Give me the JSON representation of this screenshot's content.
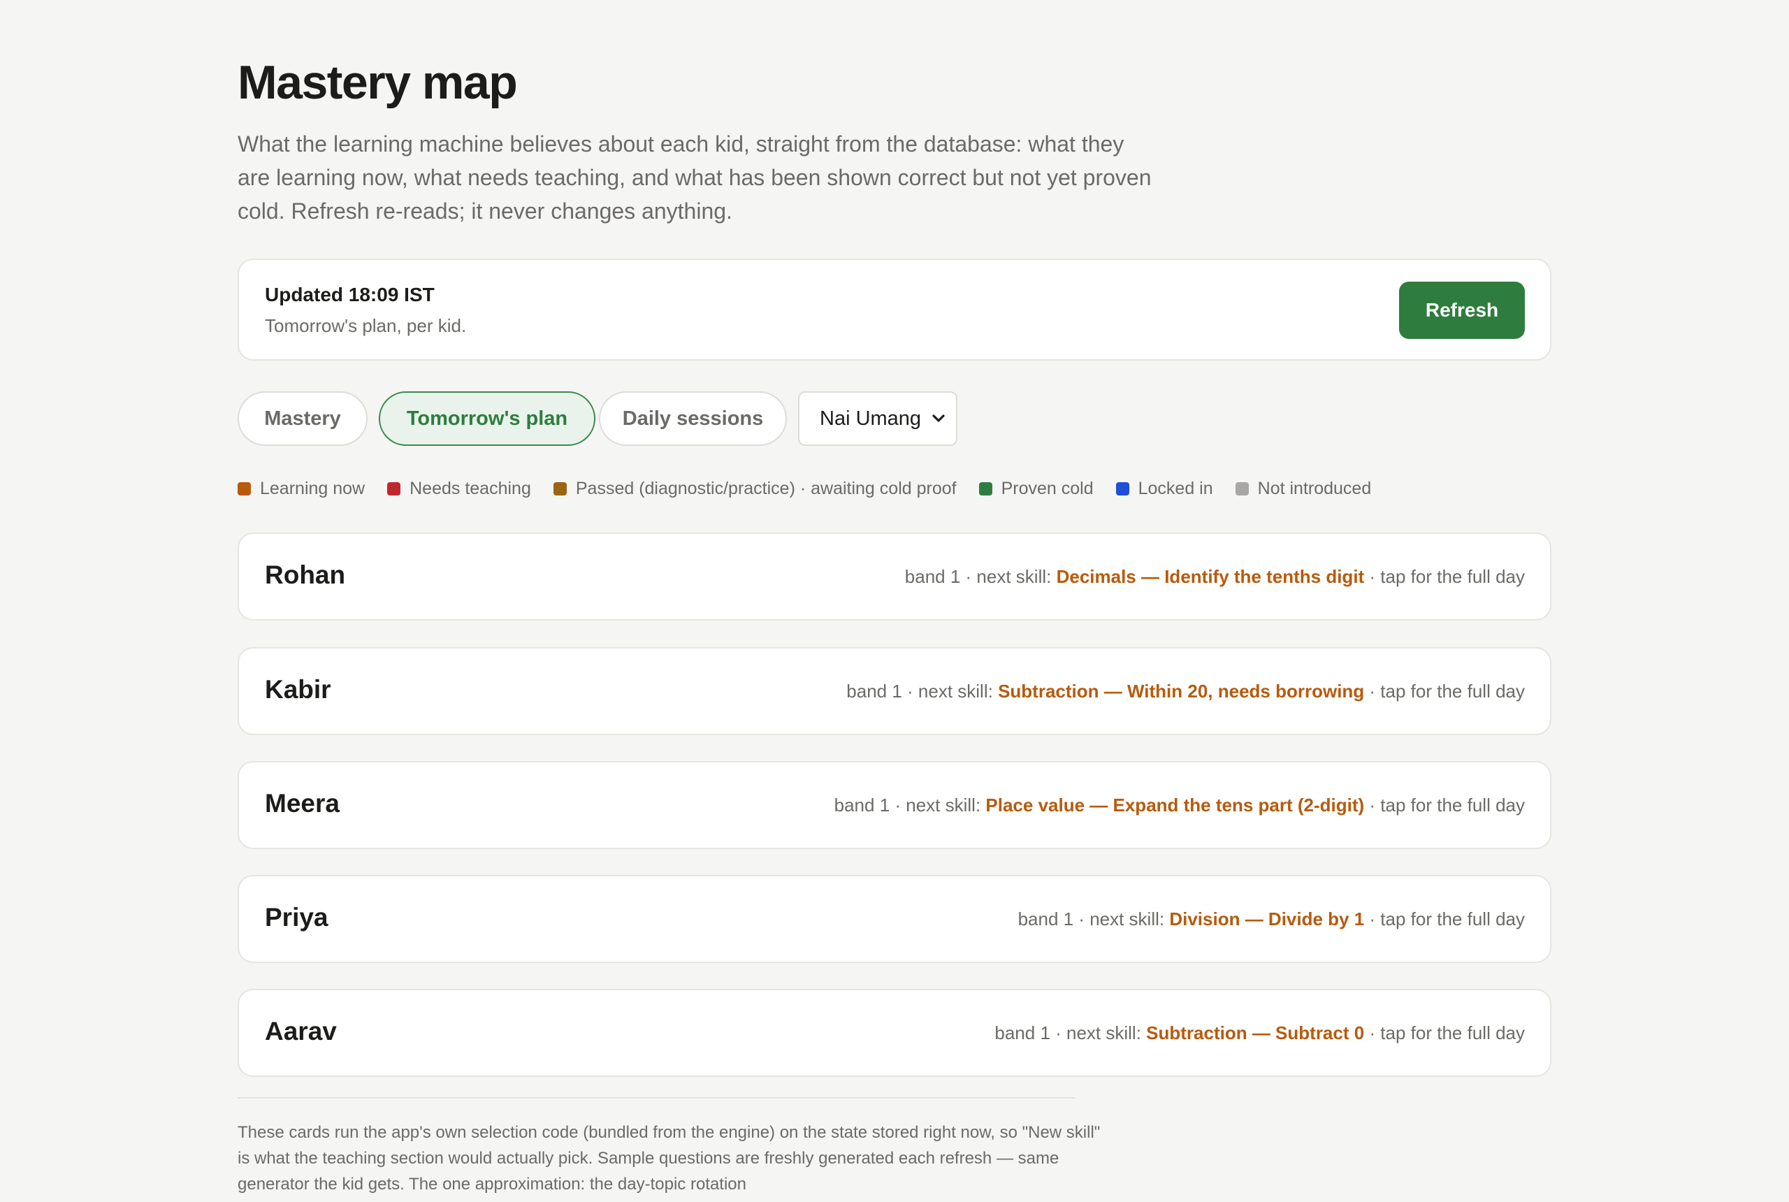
{
  "header": {
    "title": "Mastery map",
    "intro": "What the learning machine believes about each kid, straight from the database: what they are learning now, what needs teaching, and what has been shown correct but not yet proven cold. Refresh re-reads; it never changes anything."
  },
  "status": {
    "updated": "Updated 18:09 IST",
    "subtitle": "Tomorrow's plan, per kid.",
    "refresh_label": "Refresh"
  },
  "tabs": [
    {
      "label": "Mastery",
      "active": false
    },
    {
      "label": "Tomorrow's plan",
      "active": true
    },
    {
      "label": "Daily sessions",
      "active": false
    }
  ],
  "kid_select": {
    "value": "Nai Umang"
  },
  "legend": [
    {
      "label": "Learning now",
      "color": "#b85a0c"
    },
    {
      "label": "Needs teaching",
      "color": "#c0262d"
    },
    {
      "label": "Passed (diagnostic/practice) · awaiting cold proof",
      "color": "#9a6410"
    },
    {
      "label": "Proven cold",
      "color": "#2e7d3f"
    },
    {
      "label": "Locked in",
      "color": "#1f4fd6"
    },
    {
      "label": "Not introduced",
      "color": "#a8a7a3"
    }
  ],
  "kid_meta": {
    "prefix": "band 1 · next skill: ",
    "suffix": " · tap for the full day"
  },
  "kids": [
    {
      "name": "Rohan",
      "next_skill": "Decimals — Identify the tenths digit"
    },
    {
      "name": "Kabir",
      "next_skill": "Subtraction — Within 20, needs borrowing"
    },
    {
      "name": "Meera",
      "next_skill": "Place value — Expand the tens part (2-digit)"
    },
    {
      "name": "Priya",
      "next_skill": "Division — Divide by 1"
    },
    {
      "name": "Aarav",
      "next_skill": "Subtraction — Subtract 0"
    }
  ],
  "footnote": "These cards run the app's own selection code (bundled from the engine) on the state stored right now, so \"New skill\" is what the teaching section would actually pick. Sample questions are freshly generated each refresh — same generator the kid gets. The one approximation: the day-topic rotation"
}
